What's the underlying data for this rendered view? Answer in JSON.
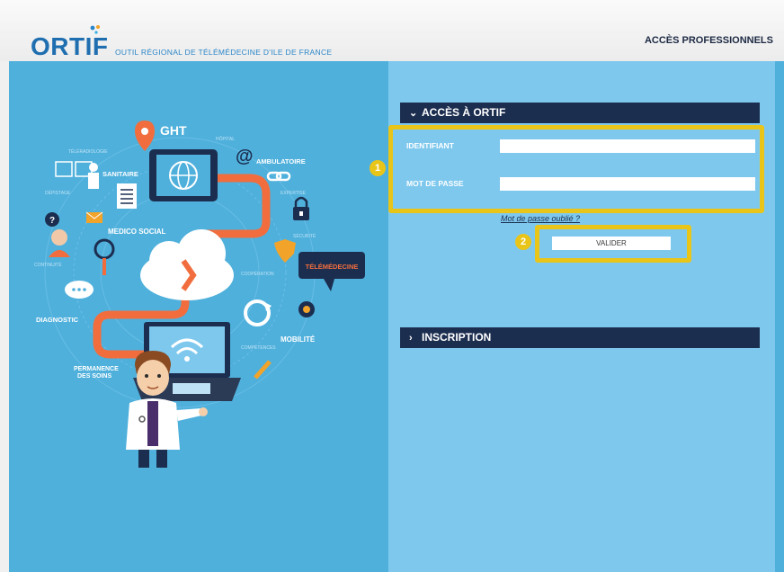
{
  "header": {
    "logo": "ORTIF",
    "tagline": "OUTIL RÉGIONAL DE TÉLÉMÉDECINE D'ILE DE FRANCE",
    "pro_access": "ACCÈS PROFESSIONNELS"
  },
  "illustration": {
    "labels": {
      "ght": "GHT",
      "ambulatoire": "AMBULATOIRE",
      "sanitaire": "SANITAIRE",
      "medico_social": "MEDICO SOCIAL",
      "telemedecine": "TÉLÉMÉDECINE",
      "diagnostic": "DIAGNOSTIC",
      "mobilite": "MOBILITÉ",
      "permanence": "PERMANENCE",
      "des_soins": "DES SOINS"
    }
  },
  "login": {
    "section_title": "ACCÈS À ORTIF",
    "identifiant_label": "IDENTIFIANT",
    "password_label": "MOT DE PASSE",
    "identifiant_value": "",
    "password_value": "",
    "forgot_link": "Mot de passe oublié ?",
    "submit_label": "VALIDER",
    "step1": "1",
    "step2": "2"
  },
  "inscription": {
    "section_title": "INSCRIPTION"
  },
  "colors": {
    "left_panel": "#4fb0dc",
    "right_panel": "#7ec8ee",
    "section_bar": "#1c2e4f",
    "highlight": "#e9c51a",
    "accent_orange": "#f26d3d"
  }
}
